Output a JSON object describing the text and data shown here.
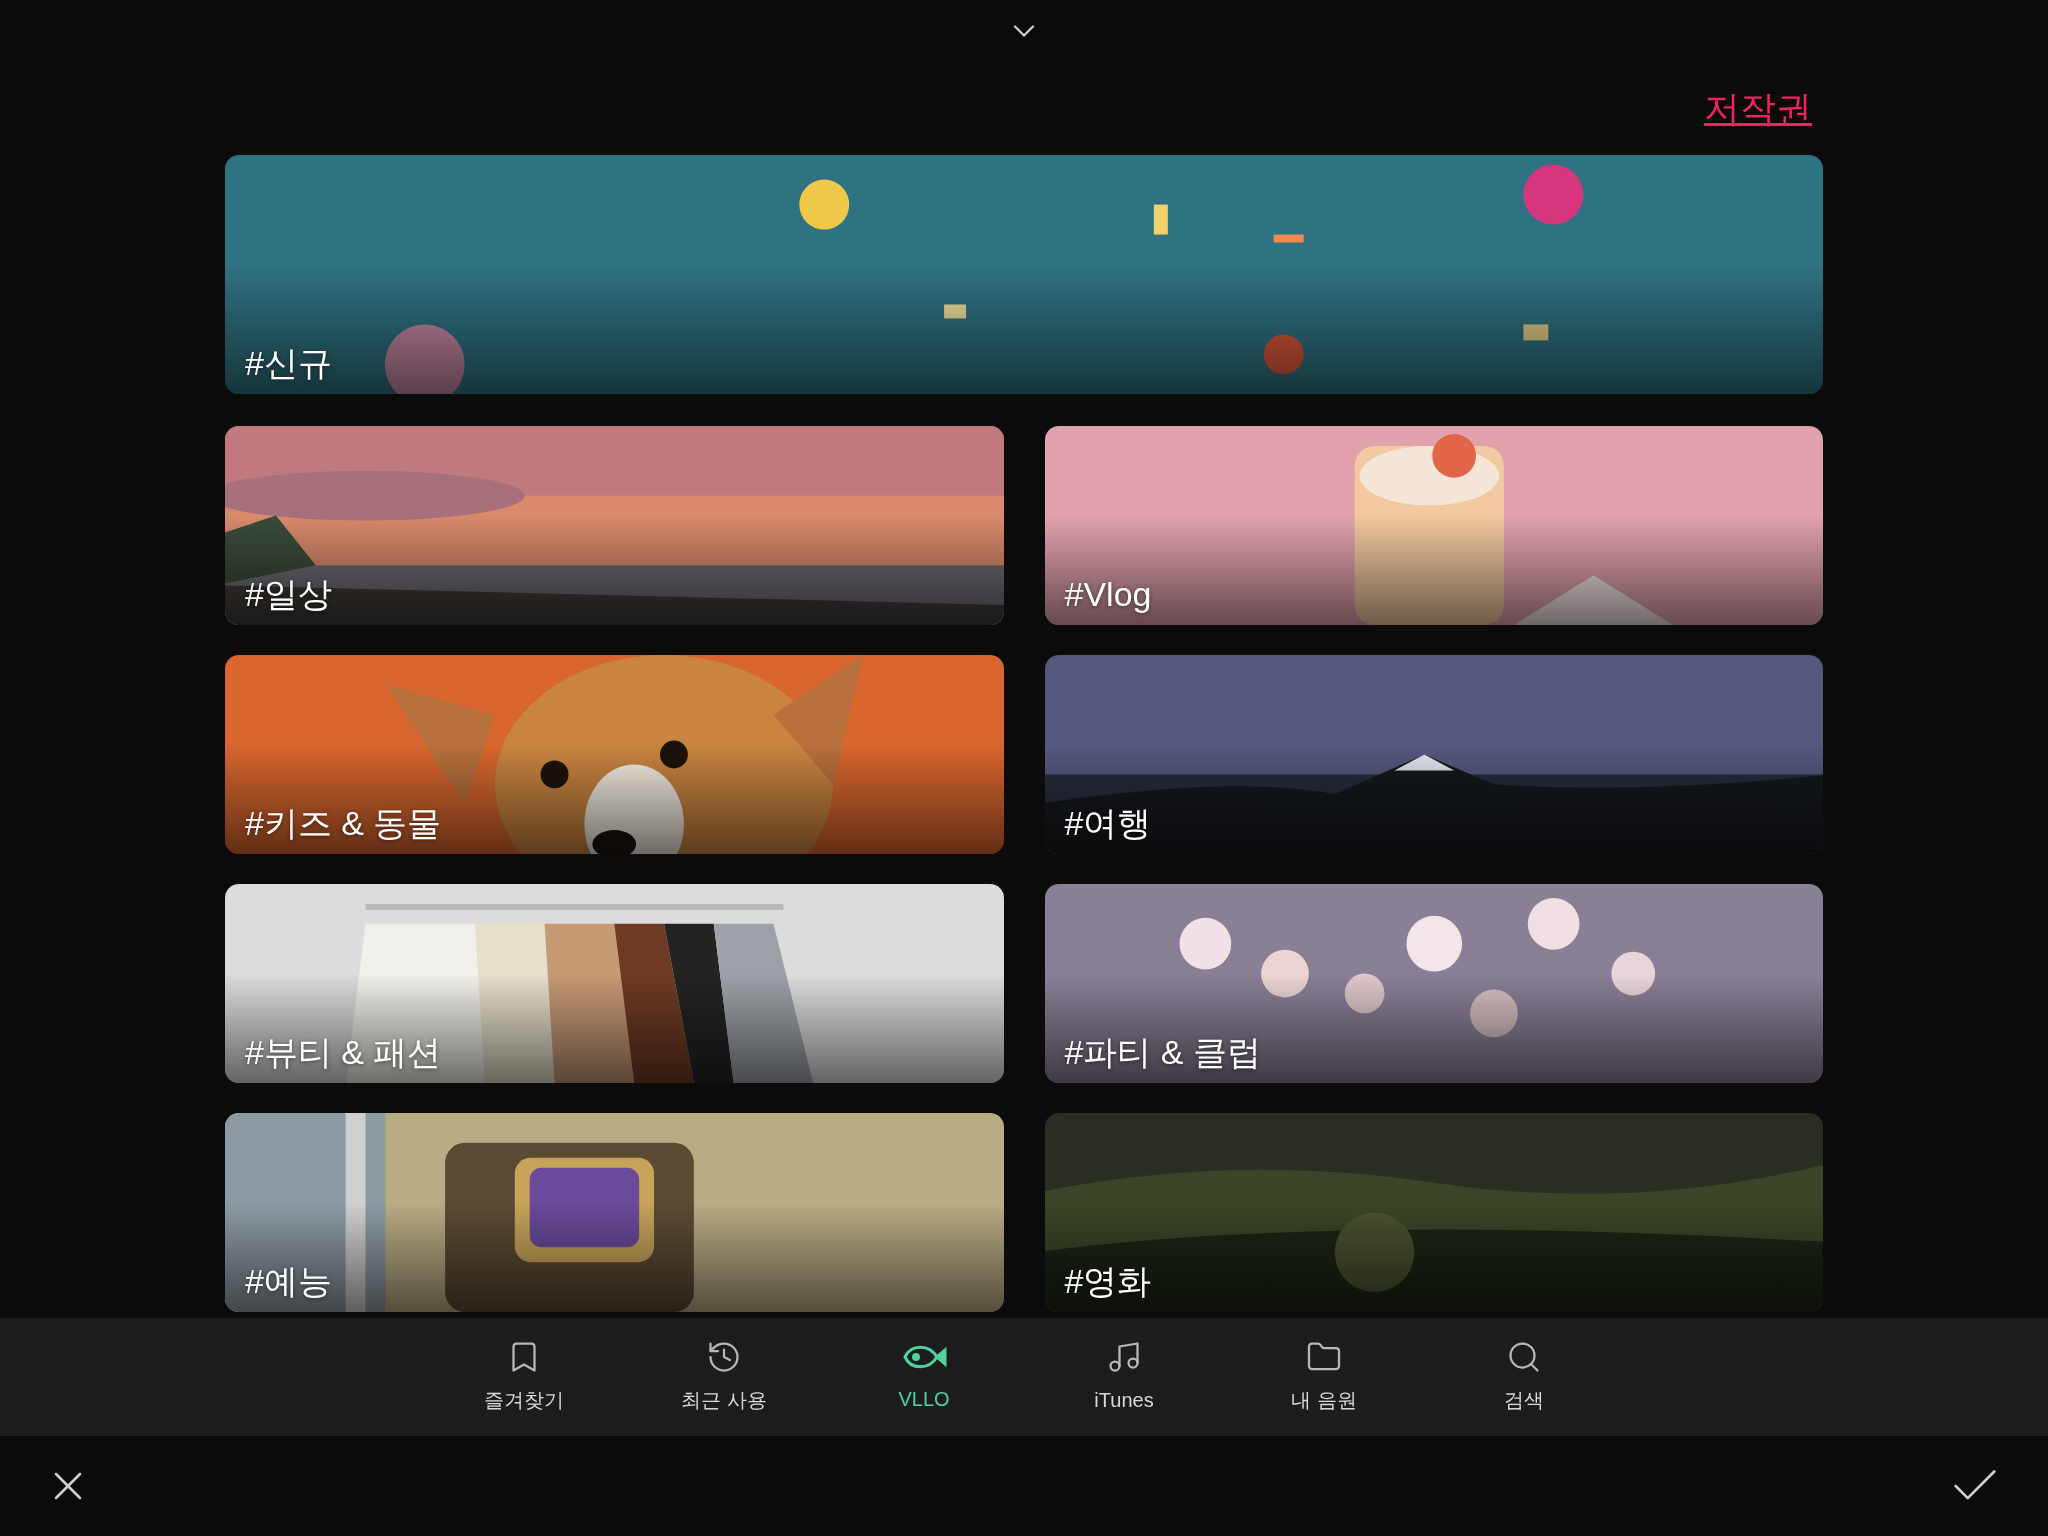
{
  "copyright_link": "저작권",
  "featured": {
    "label": "#신규"
  },
  "categories": [
    {
      "label": "#일상"
    },
    {
      "label": "#Vlog"
    },
    {
      "label": "#키즈 & 동물"
    },
    {
      "label": "#여행"
    },
    {
      "label": "#뷰티 & 패션"
    },
    {
      "label": "#파티 & 클럽"
    },
    {
      "label": "#예능"
    },
    {
      "label": "#영화"
    }
  ],
  "tabs": [
    {
      "label": "즐겨찾기",
      "kind": "bookmark",
      "selected": false
    },
    {
      "label": "최근 사용",
      "kind": "history",
      "selected": false
    },
    {
      "label": "VLLO",
      "kind": "fish",
      "selected": true
    },
    {
      "label": "iTunes",
      "kind": "music",
      "selected": false
    },
    {
      "label": "내 음원",
      "kind": "folder",
      "selected": false
    },
    {
      "label": "검색",
      "kind": "search",
      "selected": false
    }
  ]
}
